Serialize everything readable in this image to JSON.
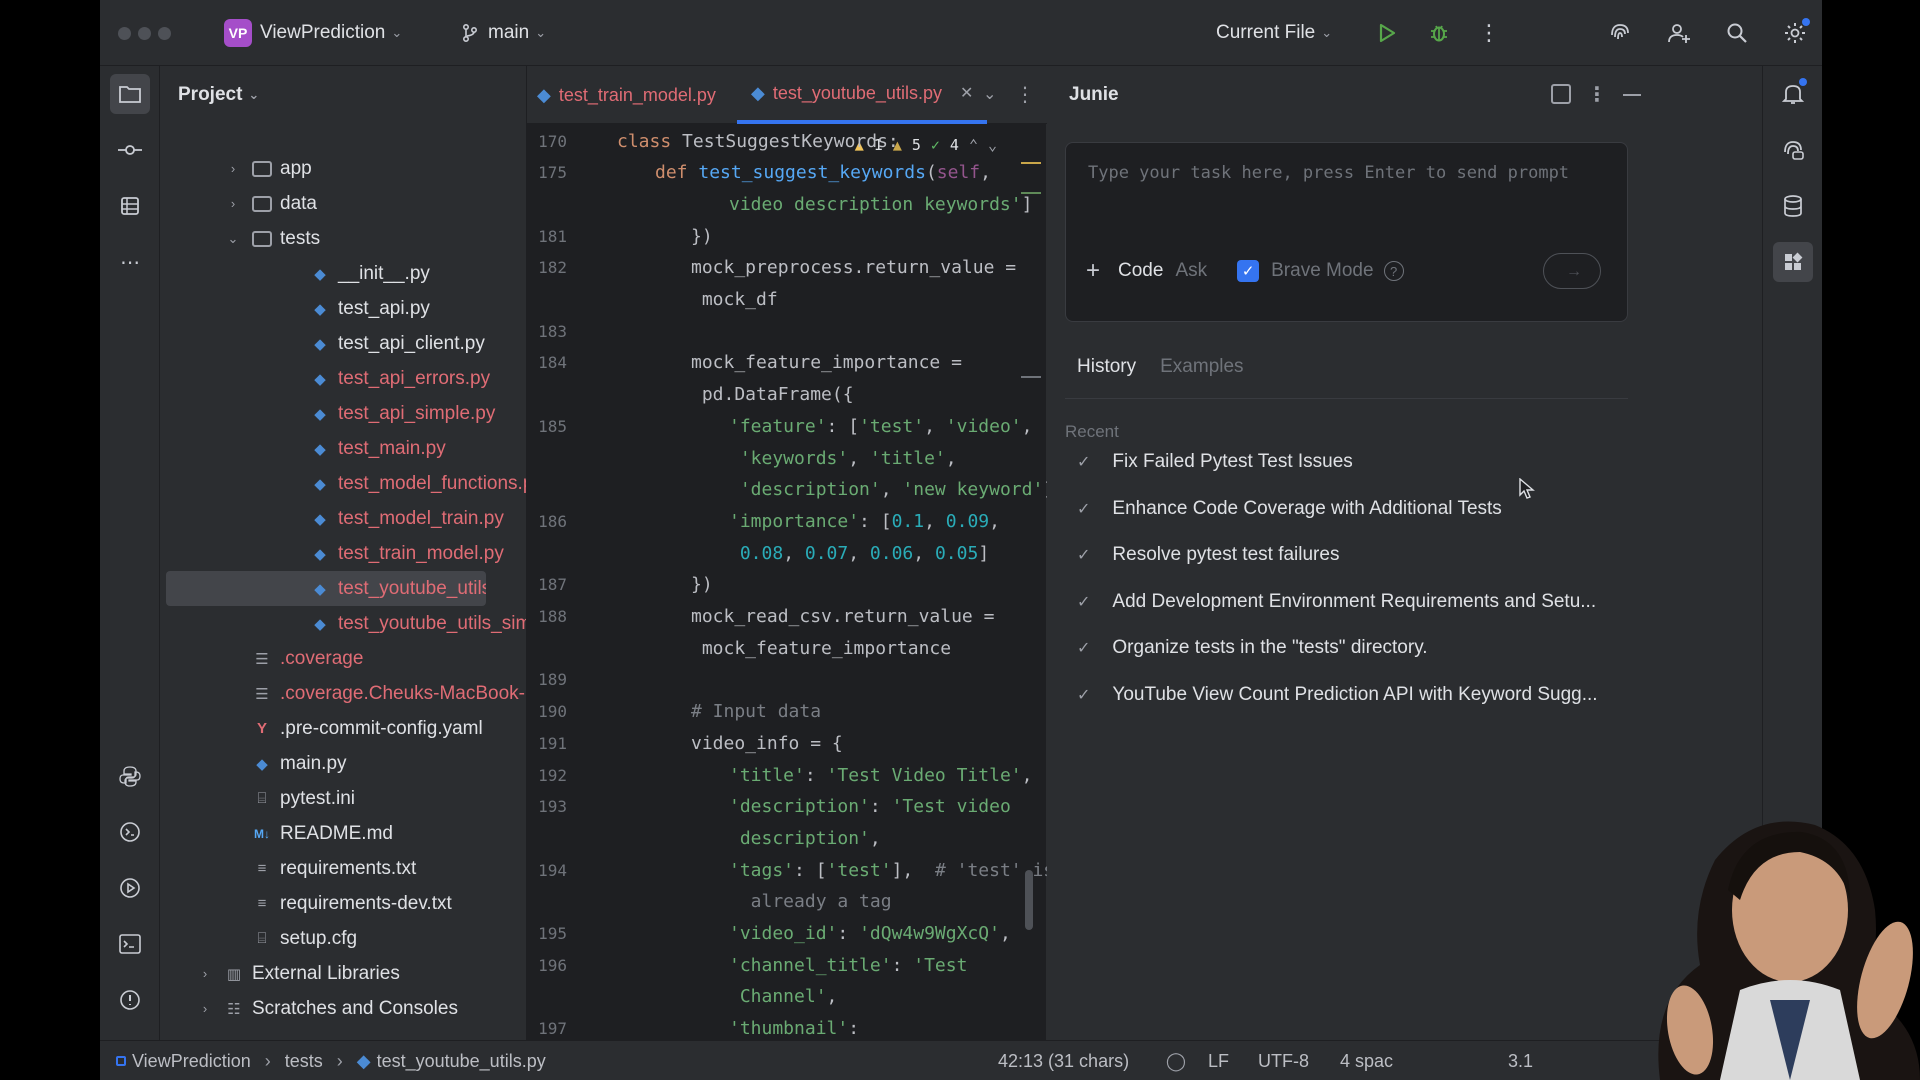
{
  "titlebar": {
    "project_badge": "VP",
    "project_name": "ViewPrediction",
    "branch": "main",
    "run_config": "Current File"
  },
  "project_panel": {
    "title": "Project",
    "tree": [
      {
        "label": "app",
        "type": "folder",
        "depth": 1,
        "expand": "collapsed",
        "color": "normal"
      },
      {
        "label": "data",
        "type": "folder",
        "depth": 1,
        "expand": "collapsed",
        "color": "normal"
      },
      {
        "label": "tests",
        "type": "folder",
        "depth": 1,
        "expand": "expanded",
        "color": "normal"
      },
      {
        "label": "__init__.py",
        "type": "python",
        "depth": 2,
        "color": "normal"
      },
      {
        "label": "test_api.py",
        "type": "python",
        "depth": 2,
        "color": "normal"
      },
      {
        "label": "test_api_client.py",
        "type": "python",
        "depth": 2,
        "color": "normal"
      },
      {
        "label": "test_api_errors.py",
        "type": "python",
        "depth": 2,
        "color": "red"
      },
      {
        "label": "test_api_simple.py",
        "type": "python",
        "depth": 2,
        "color": "red"
      },
      {
        "label": "test_main.py",
        "type": "python",
        "depth": 2,
        "color": "red"
      },
      {
        "label": "test_model_functions.py",
        "type": "python",
        "depth": 2,
        "color": "red"
      },
      {
        "label": "test_model_train.py",
        "type": "python",
        "depth": 2,
        "color": "red"
      },
      {
        "label": "test_train_model.py",
        "type": "python",
        "depth": 2,
        "color": "red"
      },
      {
        "label": "test_youtube_utils.py",
        "type": "python",
        "depth": 2,
        "color": "red",
        "selected": true
      },
      {
        "label": "test_youtube_utils_simple.",
        "type": "python",
        "depth": 2,
        "color": "red"
      },
      {
        "label": ".coverage",
        "type": "db",
        "depth": 1,
        "color": "red"
      },
      {
        "label": ".coverage.Cheuks-MacBook-",
        "type": "db",
        "depth": 1,
        "color": "red"
      },
      {
        "label": ".pre-commit-config.yaml",
        "type": "yaml",
        "depth": 1,
        "color": "normal"
      },
      {
        "label": "main.py",
        "type": "python",
        "depth": 1,
        "color": "normal"
      },
      {
        "label": "pytest.ini",
        "type": "ini",
        "depth": 1,
        "color": "normal"
      },
      {
        "label": "README.md",
        "type": "md",
        "depth": 1,
        "color": "normal"
      },
      {
        "label": "requirements.txt",
        "type": "txt",
        "depth": 1,
        "color": "normal"
      },
      {
        "label": "requirements-dev.txt",
        "type": "txt",
        "depth": 1,
        "color": "normal"
      },
      {
        "label": "setup.cfg",
        "type": "ini",
        "depth": 1,
        "color": "normal"
      },
      {
        "label": "External Libraries",
        "type": "lib",
        "depth": 0,
        "expand": "collapsed",
        "color": "normal"
      },
      {
        "label": "Scratches and Consoles",
        "type": "scratch",
        "depth": 0,
        "expand": "collapsed",
        "color": "normal"
      }
    ]
  },
  "editor": {
    "tabs": [
      {
        "label": "test_train_model.py",
        "active": false
      },
      {
        "label": "test_youtube_utils.py",
        "active": true
      }
    ],
    "inspections": {
      "warnings": "1",
      "weak_warnings": "5",
      "ok": "4"
    },
    "lines": [
      {
        "no": "170",
        "indent": 0,
        "tokens": [
          [
            "kw",
            "class "
          ],
          [
            "plain",
            "TestSuggestKeywords:"
          ]
        ]
      },
      {
        "no": "175",
        "indent": 1,
        "tokens": [
          [
            "kw",
            "def "
          ],
          [
            "fn",
            "test_suggest_keywords"
          ],
          [
            "plain",
            "("
          ],
          [
            "self",
            "self"
          ],
          [
            "plain",
            ","
          ]
        ]
      },
      {
        "no": "",
        "indent": 3,
        "tokens": [
          [
            "str",
            "video description keywords'"
          ],
          [
            "plain",
            "]"
          ]
        ]
      },
      {
        "no": "181",
        "indent": 2,
        "tokens": [
          [
            "plain",
            "})"
          ]
        ]
      },
      {
        "no": "182",
        "indent": 2,
        "tokens": [
          [
            "plain",
            "mock_preprocess.return_value ="
          ]
        ]
      },
      {
        "no": "",
        "indent": 2,
        "tokens": [
          [
            "plain",
            " mock_df"
          ]
        ]
      },
      {
        "no": "183",
        "indent": 2,
        "tokens": []
      },
      {
        "no": "184",
        "indent": 2,
        "tokens": [
          [
            "plain",
            "mock_feature_importance ="
          ]
        ]
      },
      {
        "no": "",
        "indent": 2,
        "tokens": [
          [
            "plain",
            " pd.DataFrame({"
          ]
        ]
      },
      {
        "no": "185",
        "indent": 3,
        "tokens": [
          [
            "str",
            "'feature'"
          ],
          [
            "plain",
            ": ["
          ],
          [
            "str",
            "'test'"
          ],
          [
            "plain",
            ", "
          ],
          [
            "str",
            "'video'"
          ],
          [
            "plain",
            ","
          ]
        ]
      },
      {
        "no": "",
        "indent": 3,
        "tokens": [
          [
            "str",
            " 'keywords'"
          ],
          [
            "plain",
            ", "
          ],
          [
            "str",
            "'title'"
          ],
          [
            "plain",
            ","
          ]
        ]
      },
      {
        "no": "",
        "indent": 3,
        "tokens": [
          [
            "str",
            " 'description'"
          ],
          [
            "plain",
            ", "
          ],
          [
            "str",
            "'new keyword'"
          ],
          [
            "plain",
            "],"
          ]
        ]
      },
      {
        "no": "186",
        "indent": 3,
        "tokens": [
          [
            "str",
            "'importance'"
          ],
          [
            "plain",
            ": ["
          ],
          [
            "num",
            "0.1"
          ],
          [
            "plain",
            ", "
          ],
          [
            "num",
            "0.09"
          ],
          [
            "plain",
            ","
          ]
        ]
      },
      {
        "no": "",
        "indent": 3,
        "tokens": [
          [
            "num",
            " 0.08"
          ],
          [
            "plain",
            ", "
          ],
          [
            "num",
            "0.07"
          ],
          [
            "plain",
            ", "
          ],
          [
            "num",
            "0.06"
          ],
          [
            "plain",
            ", "
          ],
          [
            "num",
            "0.05"
          ],
          [
            "plain",
            "]"
          ]
        ]
      },
      {
        "no": "187",
        "indent": 2,
        "tokens": [
          [
            "plain",
            "})"
          ]
        ]
      },
      {
        "no": "188",
        "indent": 2,
        "tokens": [
          [
            "plain",
            "mock_read_csv.return_value ="
          ]
        ]
      },
      {
        "no": "",
        "indent": 2,
        "tokens": [
          [
            "plain",
            " mock_feature_importance"
          ]
        ]
      },
      {
        "no": "189",
        "indent": 2,
        "tokens": []
      },
      {
        "no": "190",
        "indent": 2,
        "tokens": [
          [
            "cm",
            "# Input data"
          ]
        ]
      },
      {
        "no": "191",
        "indent": 2,
        "tokens": [
          [
            "plain",
            "video_info = {"
          ]
        ]
      },
      {
        "no": "192",
        "indent": 3,
        "tokens": [
          [
            "str",
            "'title'"
          ],
          [
            "plain",
            ": "
          ],
          [
            "str",
            "'Test Video Title'"
          ],
          [
            "plain",
            ","
          ]
        ]
      },
      {
        "no": "193",
        "indent": 3,
        "tokens": [
          [
            "str",
            "'description'"
          ],
          [
            "plain",
            ": "
          ],
          [
            "str",
            "'Test video"
          ]
        ]
      },
      {
        "no": "",
        "indent": 3,
        "tokens": [
          [
            "str",
            " description'"
          ],
          [
            "plain",
            ","
          ]
        ]
      },
      {
        "no": "194",
        "indent": 3,
        "tokens": [
          [
            "str",
            "'tags'"
          ],
          [
            "plain",
            ": ["
          ],
          [
            "str",
            "'test'"
          ],
          [
            "plain",
            "],  "
          ],
          [
            "cm",
            "# 'test' is"
          ]
        ]
      },
      {
        "no": "",
        "indent": 3,
        "tokens": [
          [
            "cm",
            "  already a tag"
          ]
        ]
      },
      {
        "no": "195",
        "indent": 3,
        "tokens": [
          [
            "str",
            "'video_id'"
          ],
          [
            "plain",
            ": "
          ],
          [
            "str",
            "'dQw4w9WgXcQ'"
          ],
          [
            "plain",
            ","
          ]
        ]
      },
      {
        "no": "196",
        "indent": 3,
        "tokens": [
          [
            "str",
            "'channel_title'"
          ],
          [
            "plain",
            ": "
          ],
          [
            "str",
            "'Test"
          ]
        ]
      },
      {
        "no": "",
        "indent": 3,
        "tokens": [
          [
            "str",
            " Channel'"
          ],
          [
            "plain",
            ","
          ]
        ]
      },
      {
        "no": "197",
        "indent": 3,
        "tokens": [
          [
            "str",
            "'thumbnail'"
          ],
          [
            "plain",
            ":"
          ]
        ]
      }
    ]
  },
  "junie": {
    "title": "Junie",
    "prompt_placeholder": "Type your task here, press Enter to send prompt",
    "mode_code": "Code",
    "mode_ask": "Ask",
    "brave_mode": "Brave Mode",
    "tab_history": "History",
    "tab_examples": "Examples",
    "recent_label": "Recent",
    "history": [
      "Fix Failed Pytest Test Issues",
      "Enhance Code Coverage with Additional Tests",
      "Resolve pytest test failures",
      "Add Development Environment Requirements and Setu...",
      "Organize tests in the \"tests\" directory.",
      "YouTube View Count Prediction API with Keyword Sugg..."
    ]
  },
  "statusbar": {
    "crumb_project": "ViewPrediction",
    "crumb_folder": "tests",
    "crumb_file": "test_youtube_utils.py",
    "position": "42:13 (31 chars)",
    "line_sep": "LF",
    "encoding": "UTF-8",
    "indent": "4 spac",
    "python": "3.1"
  },
  "colors": {
    "accent": "#3574f0",
    "modified": "#e06c75",
    "badge": "#a54ec9"
  }
}
